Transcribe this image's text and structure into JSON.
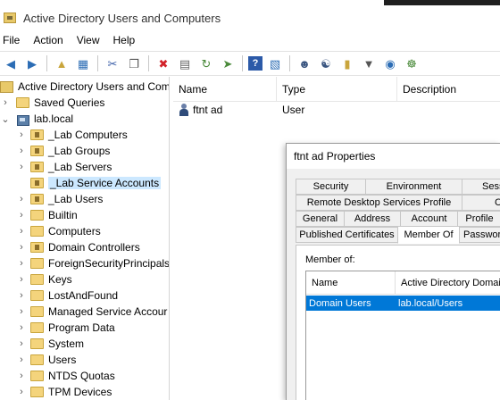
{
  "window": {
    "title": "Active Directory Users and Computers"
  },
  "menu": [
    "File",
    "Action",
    "View",
    "Help"
  ],
  "toolbar": [
    "back-arrow-icon",
    "forward-arrow-icon",
    "up-folder-icon",
    "details-view-icon",
    "cut-icon",
    "copy-icon",
    "delete-icon",
    "properties-icon",
    "refresh-icon",
    "export-list-icon",
    "help-icon",
    "console-icon",
    "new-user-icon",
    "new-group-icon",
    "new-ou-icon",
    "filter-icon",
    "find-icon",
    "add-to-group-icon"
  ],
  "tree": {
    "root_label": "Active Directory Users and Com",
    "saved_queries": "Saved Queries",
    "domain": "lab.local",
    "items": [
      "_Lab Computers",
      "_Lab Groups",
      "_Lab Servers",
      "_Lab Service Accounts",
      "_Lab Users",
      "Builtin",
      "Computers",
      "Domain Controllers",
      "ForeignSecurityPrincipals",
      "Keys",
      "LostAndFound",
      "Managed Service Accour",
      "Program Data",
      "System",
      "Users",
      "NTDS Quotas",
      "TPM Devices"
    ],
    "selected_index": 3
  },
  "list": {
    "columns": [
      "Name",
      "Type",
      "Description"
    ],
    "rows": [
      {
        "name": "ftnt ad",
        "type": "User",
        "description": ""
      }
    ]
  },
  "dialog": {
    "title": "ftnt ad Properties",
    "tabs_row1": [
      "Security",
      "Environment",
      "Sess"
    ],
    "tabs_row2": [
      "Remote Desktop Services Profile",
      "C"
    ],
    "tabs_row3": [
      "General",
      "Address",
      "Account",
      "Profile"
    ],
    "tabs_row4": [
      "Published Certificates",
      "Member Of",
      "Passwor"
    ],
    "active_tab": "Member Of",
    "member_of_label": "Member of:",
    "columns": [
      "Name",
      "Active Directory Domain"
    ],
    "rows": [
      {
        "name": "Domain Users",
        "folder": "lab.local/Users"
      }
    ]
  }
}
